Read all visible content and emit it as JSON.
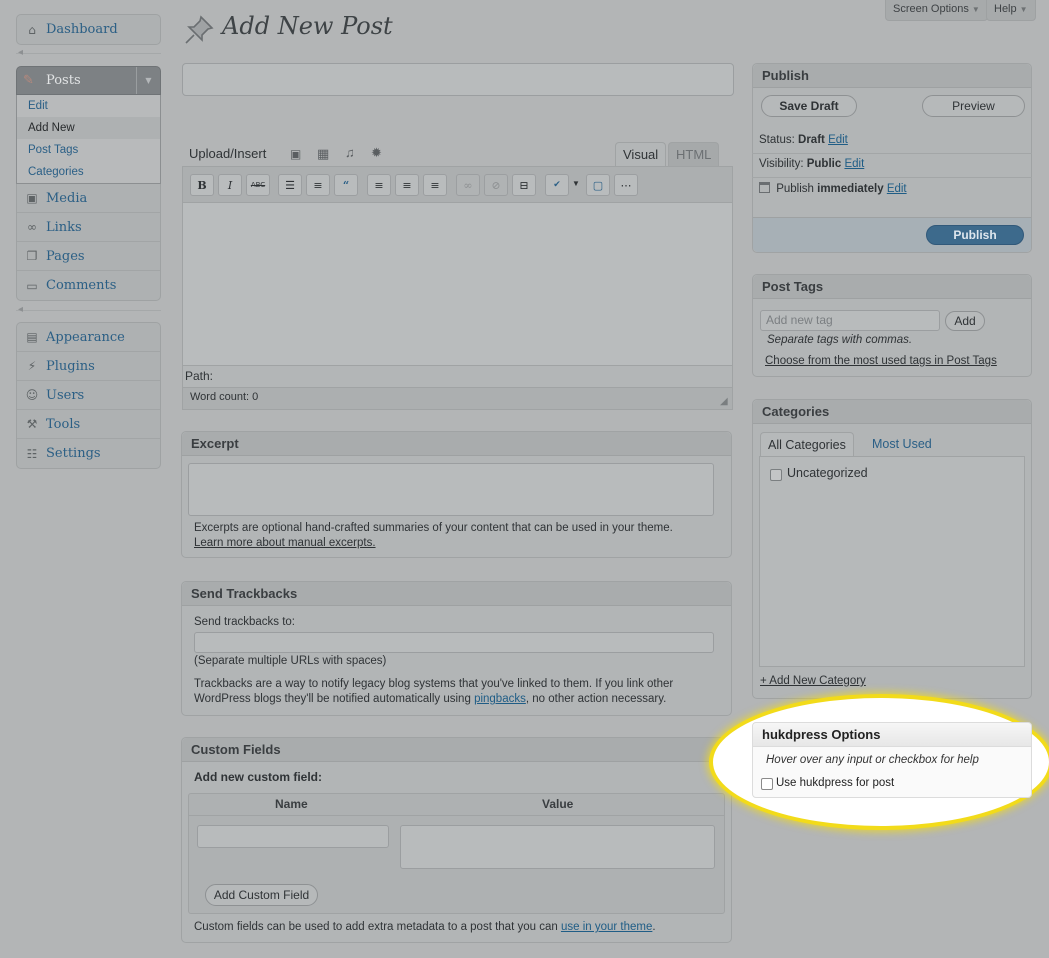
{
  "top_buttons": {
    "screen_options": "Screen Options",
    "help": "Help"
  },
  "page_title": "Add New Post",
  "sidebar": {
    "dashboard": "Dashboard",
    "posts": "Posts",
    "posts_sub": [
      "Edit",
      "Add New",
      "Post Tags",
      "Categories"
    ],
    "group1": [
      "Media",
      "Links",
      "Pages",
      "Comments"
    ],
    "group2": [
      "Appearance",
      "Plugins",
      "Users",
      "Tools",
      "Settings"
    ]
  },
  "editor": {
    "upload_insert": "Upload/Insert",
    "tab_visual": "Visual",
    "tab_html": "HTML",
    "path_label": "Path:",
    "word_count": "Word count: 0"
  },
  "excerpt": {
    "title": "Excerpt",
    "help": "Excerpts are optional hand-crafted summaries of your content that can be used in your theme.",
    "link": "Learn more about manual excerpts."
  },
  "trackbacks": {
    "title": "Send Trackbacks",
    "label": "Send trackbacks to:",
    "separate": "(Separate multiple URLs with spaces)",
    "desc_1": "Trackbacks are a way to notify legacy blog systems that you've linked to them. If you link other",
    "desc_2a": "WordPress blogs they'll be notified automatically using",
    "desc_link": "pingbacks",
    "desc_2b": ", no other action necessary."
  },
  "custom_fields": {
    "title": "Custom Fields",
    "subtitle": "Add new custom field:",
    "col_name": "Name",
    "col_value": "Value",
    "add_button": "Add Custom Field",
    "footer_a": "Custom fields can be used to add extra metadata to a post that you can",
    "footer_link": "use in your theme",
    "footer_b": "."
  },
  "publish": {
    "title": "Publish",
    "save_draft": "Save Draft",
    "preview": "Preview",
    "status_label": "Status:",
    "status_value": "Draft",
    "visibility_label": "Visibility:",
    "visibility_value": "Public",
    "publish_label": "Publish",
    "publish_value": "immediately",
    "edit": "Edit",
    "publish_button": "Publish"
  },
  "post_tags": {
    "title": "Post Tags",
    "placeholder": "Add new tag",
    "add": "Add",
    "hint": "Separate tags with commas.",
    "link": "Choose from the most used tags in Post Tags"
  },
  "categories": {
    "title": "Categories",
    "tab_all": "All Categories",
    "tab_most": "Most Used",
    "items": [
      "Uncategorized"
    ],
    "add_link": "+ Add New Category"
  },
  "hukdpress": {
    "title": "hukdpress Options",
    "hint": "Hover over any input or checkbox for help",
    "checkbox_label": "Use hukdpress for post"
  }
}
